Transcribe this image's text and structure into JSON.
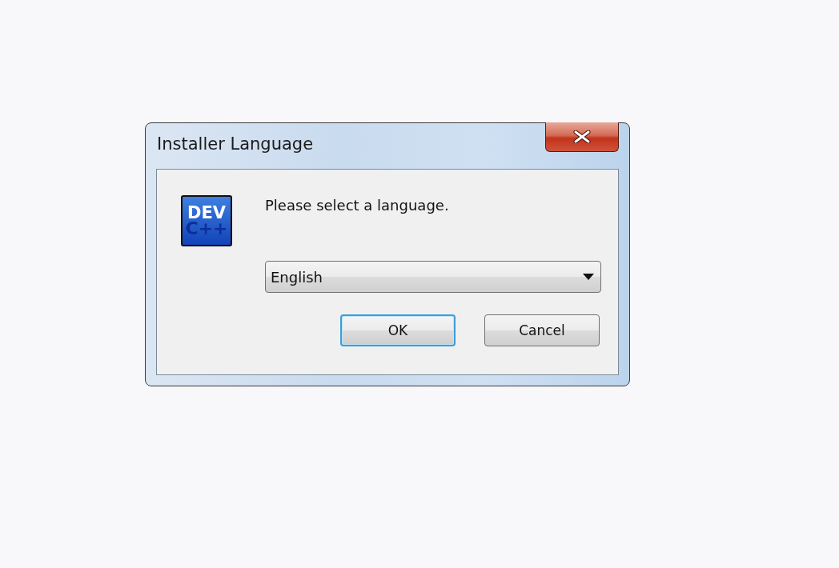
{
  "window": {
    "title": "Installer Language"
  },
  "logo": {
    "lines": [
      "DEV",
      "C++"
    ]
  },
  "prompt": "Please select a language.",
  "language_select": {
    "value": "English"
  },
  "buttons": [
    {
      "label": "OK",
      "default": true
    },
    {
      "label": "Cancel",
      "default": false
    }
  ]
}
